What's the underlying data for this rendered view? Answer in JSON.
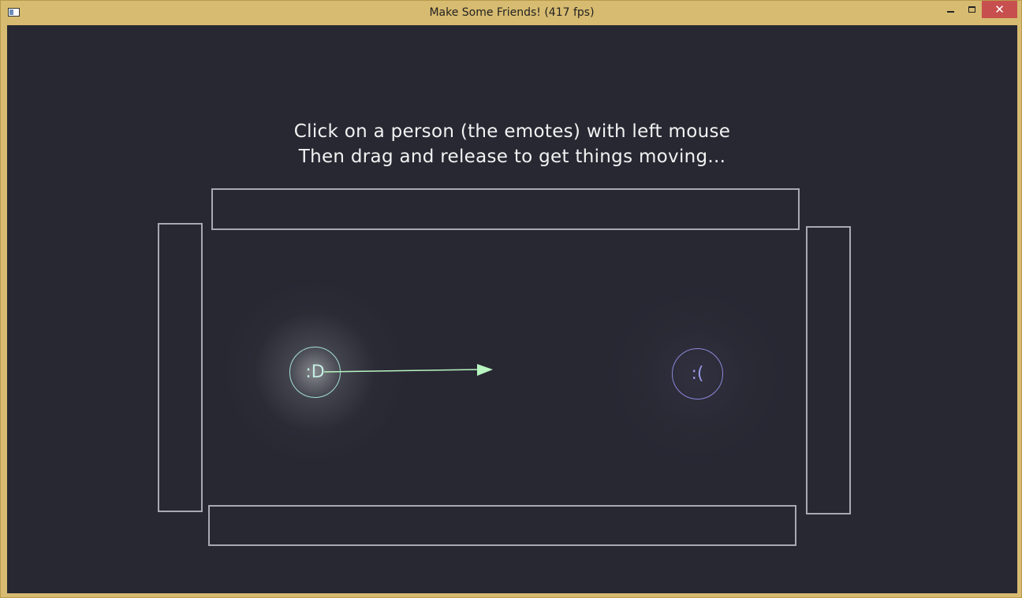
{
  "window": {
    "title": "Make Some Friends!  (417 fps)",
    "minimize_icon": "minimize-icon",
    "maximize_icon": "maximize-icon",
    "close_glyph": "✕"
  },
  "instructions": {
    "line1": "Click on a person (the emotes) with left mouse",
    "line2": "Then drag and release to get things moving..."
  },
  "people": {
    "happy": {
      "emote": ":D",
      "color": "#a6e0d3"
    },
    "sad": {
      "emote": ":(",
      "color": "#8a88d8"
    }
  },
  "colors": {
    "background": "#282833",
    "wall": "#a9a9b3",
    "drag_arrow": "#b8f5c0",
    "frame": "#d7bb70",
    "close_button": "#c7504f"
  }
}
